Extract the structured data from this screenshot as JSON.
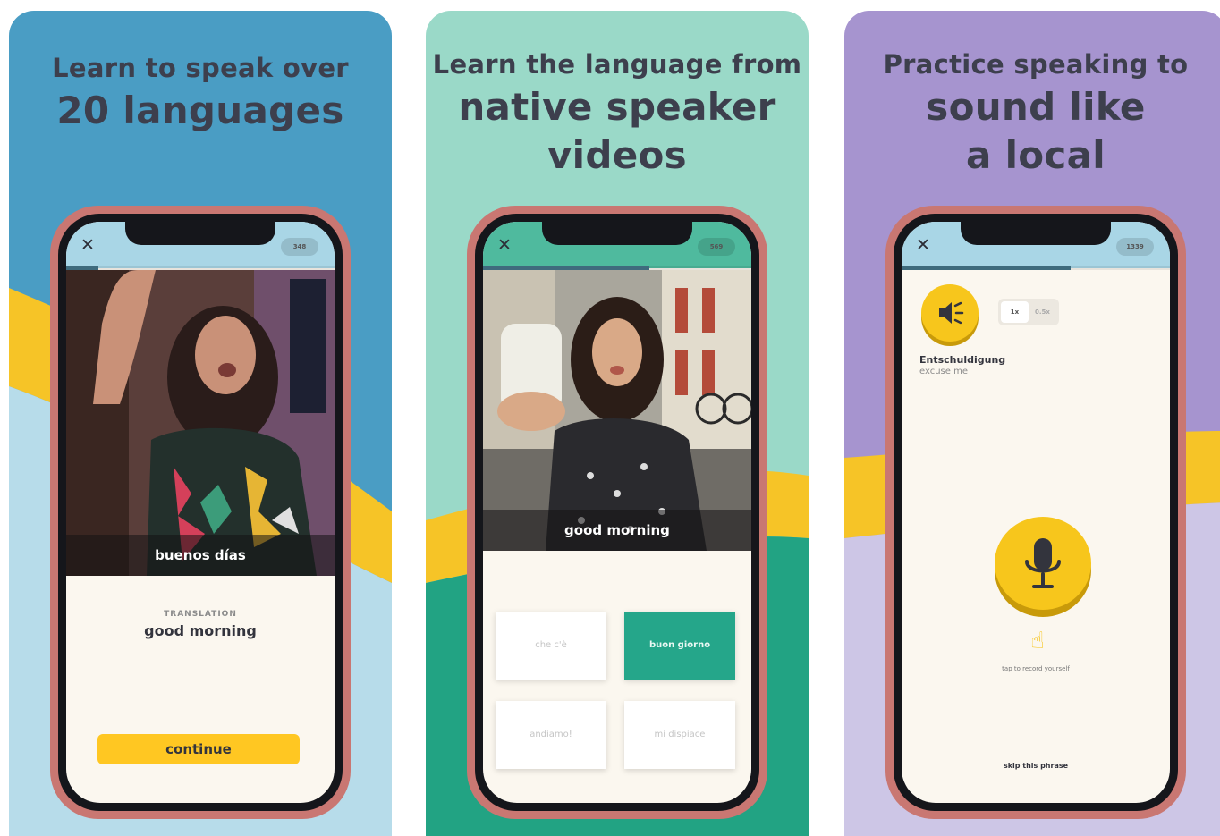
{
  "panels": [
    {
      "headline_line1": "Learn to speak over",
      "headline_line2": "20 languages",
      "close_glyph": "✕",
      "score": "348",
      "caption": "buenos días",
      "translation_label": "TRANSLATION",
      "translation_value": "good morning",
      "continue_label": "continue"
    },
    {
      "headline_line1": "Learn the language from",
      "headline_line2": "native speaker",
      "headline_line3": "videos",
      "close_glyph": "✕",
      "score": "569",
      "caption": "good morning",
      "choices": [
        "che c'è",
        "buon giorno",
        "andiamo!",
        "mi dispiace"
      ]
    },
    {
      "headline_line1": "Practice speaking to",
      "headline_line2": "sound like",
      "headline_line3": "a local",
      "close_glyph": "✕",
      "score": "1339",
      "speed_normal": "1x",
      "speed_slow": "0.5x",
      "word": "Entschuldigung",
      "word_translation": "excuse me",
      "tap_hint": "tap to record yourself",
      "skip_label": "skip this phrase"
    }
  ],
  "progress": [
    0.12,
    0.62,
    0.63
  ],
  "colors": {
    "blue_bg": "#4a9dc4",
    "mint_bg": "#9ad9c8",
    "purple_bg": "#a694cf",
    "yellow": "#ffc722",
    "green": "#25a68a",
    "phone_frame": "#c97772"
  },
  "icons": [
    "close-icon",
    "speaker-icon",
    "microphone-icon",
    "pointing-hand-icon"
  ]
}
